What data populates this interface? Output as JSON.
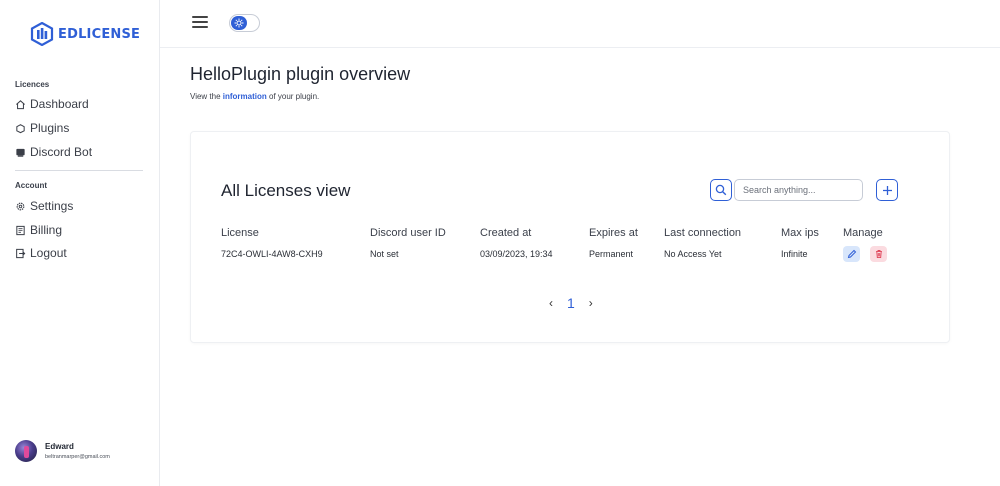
{
  "brand": {
    "name": "EDLICENSE",
    "color": "#2f5fd6"
  },
  "sidebar": {
    "sections": [
      {
        "label": "Licences",
        "items": [
          {
            "label": "Dashboard",
            "icon": "home-icon"
          },
          {
            "label": "Plugins",
            "icon": "puzzle-icon"
          },
          {
            "label": "Discord Bot",
            "icon": "bot-icon"
          }
        ]
      },
      {
        "label": "Account",
        "items": [
          {
            "label": "Settings",
            "icon": "gear-icon"
          },
          {
            "label": "Billing",
            "icon": "billing-icon"
          },
          {
            "label": "Logout",
            "icon": "logout-icon"
          }
        ]
      }
    ],
    "user": {
      "name": "Edward",
      "email": "beltranmarper@gmail.com"
    }
  },
  "topbar": {
    "menu_icon": "hamburger-icon",
    "theme_toggle_icon": "sun-icon"
  },
  "page": {
    "title": "HelloPlugin plugin overview",
    "subtitle_prefix": "View the ",
    "subtitle_link": "information",
    "subtitle_suffix": " of your plugin."
  },
  "licenses_card": {
    "title": "All Licenses view",
    "search_placeholder": "Search anything...",
    "columns": [
      "License",
      "Discord user ID",
      "Created at",
      "Expires at",
      "Last connection",
      "Max ips",
      "Manage"
    ],
    "rows": [
      {
        "license": "72C4-OWLI-4AW8-CXH9",
        "discord_user_id": "Not set",
        "created_at": "03/09/2023, 19:34",
        "expires_at": "Permanent",
        "last_connection": "No Access Yet",
        "max_ips": "Infinite"
      }
    ],
    "pagination": {
      "prev": "‹",
      "current_page": "1",
      "next": "›"
    }
  },
  "colors": {
    "accent": "#2f5fd6",
    "edit_bg": "#d8e6fb",
    "delete_bg": "#fbdbe0",
    "delete_icon": "#e0455a"
  }
}
